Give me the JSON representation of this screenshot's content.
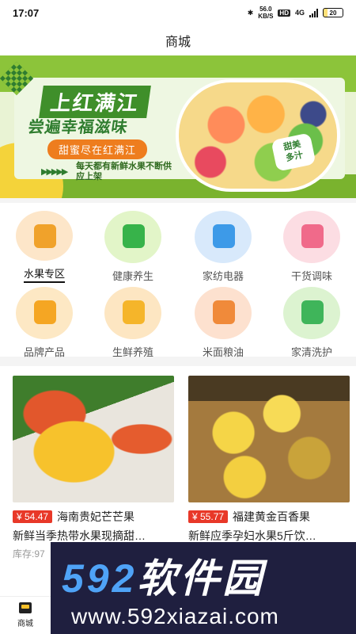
{
  "status_bar": {
    "time": "17:07",
    "net_speed": "56.0",
    "net_unit": "KB/S",
    "hd": "HD",
    "net_type": "4G",
    "battery": "20"
  },
  "header": {
    "title": "商城"
  },
  "banner": {
    "title_line1": "上红满江",
    "title_line2": "尝遍幸福滋味",
    "pill": "甜蜜尽在红满江",
    "desc": "每天都有新鲜水果不断供应上架",
    "badge_line1": "甜美",
    "badge_line2": "多汁"
  },
  "categories": [
    {
      "label": "水果专区",
      "icon": "fruit-icon",
      "active": true
    },
    {
      "label": "健康养生",
      "icon": "health-icon",
      "active": false
    },
    {
      "label": "家纺电器",
      "icon": "appliance-icon",
      "active": false
    },
    {
      "label": "干货调味",
      "icon": "seasoning-icon",
      "active": false
    },
    {
      "label": "品牌产品",
      "icon": "brand-icon",
      "active": false
    },
    {
      "label": "生鲜养殖",
      "icon": "fresh-icon",
      "active": false
    },
    {
      "label": "米面粮油",
      "icon": "grain-icon",
      "active": false
    },
    {
      "label": "家清洗护",
      "icon": "cleaning-icon",
      "active": false
    }
  ],
  "colors": {
    "category_bg": [
      "#fde6c9",
      "#e2f5c8",
      "#d8e9fb",
      "#fcdde3",
      "#fde8c4",
      "#fde6c2",
      "#fde1cf",
      "#dcf3d0"
    ],
    "category_fg": [
      "#f0a22b",
      "#37b34a",
      "#3d9ae8",
      "#f06a8a",
      "#f5a623",
      "#f5b52a",
      "#f08a3a",
      "#3fb55a"
    ],
    "price_tag": "#e83828"
  },
  "products": [
    {
      "price": "¥ 54.47",
      "title_line1": "海南贵妃芒芒果",
      "title_line2": "新鲜当季热带水果现摘甜…",
      "stock": "库存:97"
    },
    {
      "price": "¥ 55.77",
      "title_line1": "福建黄金百香果",
      "title_line2": "新鲜应季孕妇水果5斤饮…",
      "stock": ""
    }
  ],
  "watermark": {
    "brand_a": "592",
    "brand_b": "软件园",
    "url": "www.592xiazai.com"
  },
  "tabbar": {
    "items": [
      {
        "label": "商城",
        "icon": "shop-icon"
      }
    ]
  }
}
